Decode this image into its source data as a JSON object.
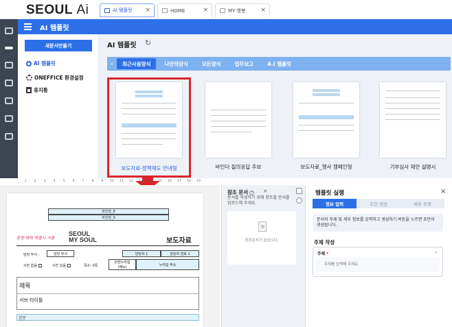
{
  "app": {
    "logo_main": "SEOUL",
    "logo_ai": "Ai"
  },
  "tabs": [
    {
      "label": "AI 템플릿",
      "active": true
    },
    {
      "label": "HOME",
      "active": false
    },
    {
      "label": "MY 챗봇",
      "active": false
    }
  ],
  "header": {
    "title": "AI 템플릿"
  },
  "nav": {
    "new_doc": "새문서만들기",
    "items": [
      {
        "label": "AI 템플릿",
        "selected": true
      },
      {
        "label": "ONEFFICE 환경설정",
        "selected": false
      },
      {
        "label": "휴지통",
        "selected": false
      }
    ]
  },
  "gallery": {
    "title": "AI 템플릿",
    "categories": [
      {
        "label": "최근사용양식",
        "selected": true
      },
      {
        "label": "나만의양식",
        "selected": false
      },
      {
        "label": "모든양식",
        "selected": false
      },
      {
        "label": "업무보고",
        "selected": false
      },
      {
        "label": "A.I 템플릿",
        "selected": false
      }
    ],
    "cards": [
      {
        "label": "보도자료-정책제도 안내형",
        "selected": true
      },
      {
        "label": "바인더 질의응답 추보",
        "selected": false
      },
      {
        "label": "보도자료_행사 캠페인형",
        "selected": false
      },
      {
        "label": "기부심사 제안 설명시",
        "selected": false
      }
    ]
  },
  "ruler": [
    "1",
    "2",
    "3",
    "4",
    "5",
    "6",
    "7",
    "8",
    "9",
    "10",
    "11",
    "12",
    "13",
    "14",
    "15",
    "16",
    "17",
    "18",
    "19"
  ],
  "document": {
    "cell_top1": "비인당_8",
    "cell_top2": "비인당_9",
    "brand_script": "동행·매력 특별시 서울",
    "brand_seoul": "SEOUL",
    "brand_my": "MY SOUL",
    "press_title": "보도자료",
    "row1_label": "담당 부서 :",
    "row1_value": "담당 부서",
    "row1_c1": "담당자 1",
    "row1_c2": "담당자 번호 1",
    "row2_a": "사진 없음",
    "row2_b": "사진 있음",
    "row2_c": "쪽수: 0쪽",
    "row2_d": "관련누리집\n(메뉴)",
    "row2_e": "누리집 주소",
    "doc_title": "제목",
    "doc_subtitle": "서브 타이틀",
    "doc_body": "본문"
  },
  "ref_panel": {
    "title": "참조 문서",
    "help": "?",
    "desc": "문서를 작성하기 위해 참조할 문서를 업로드해 주세요.",
    "empty": "참조문서가 없습니다."
  },
  "run_panel": {
    "title": "템플릿 실행",
    "steps": [
      {
        "label": "정보 입력",
        "selected": true
      },
      {
        "label": "초안 생성",
        "selected": false
      },
      {
        "label": "세부 조정",
        "selected": false
      }
    ],
    "hint": "문서의 주제 및 세부 정보를 입력하고 생성하기 버튼을 누르면 초안이 생성됩니다.",
    "section": "주제 작성",
    "topic_label": "주제",
    "topic_required": "*",
    "topic_placeholder": "주제를 입력해 주세요."
  },
  "colors": {
    "accent": "#2d6fe8",
    "highlight": "#d8262b",
    "rail": "#3d4452"
  }
}
